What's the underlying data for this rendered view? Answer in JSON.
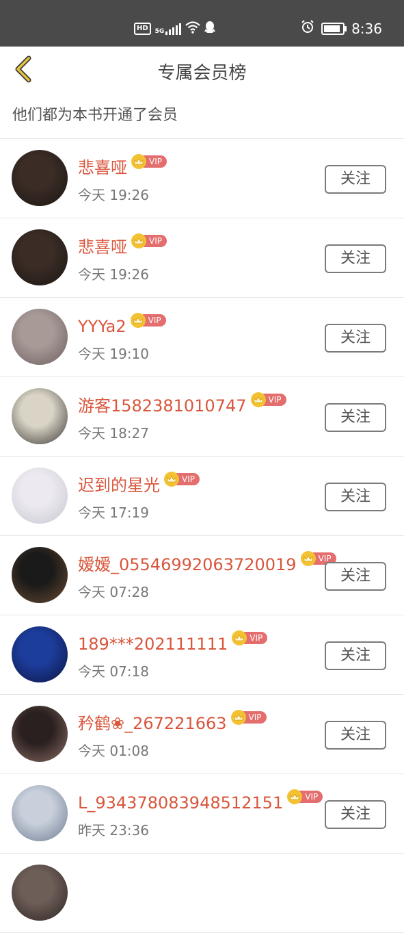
{
  "status_bar": {
    "network": "HD",
    "signal": "5G",
    "time": "8:36",
    "icons": [
      "hd-icon",
      "5g-signal-icon",
      "wifi-icon",
      "qq-icon",
      "alarm-icon",
      "battery-icon"
    ],
    "battery_level": 0.9
  },
  "header": {
    "title": "专属会员榜",
    "back_icon": "chevron-left-icon"
  },
  "subtitle": "他们都为本书开通了会员",
  "vip_label": "VIP",
  "follow_label": "关注",
  "members": [
    {
      "name": "悲喜哑",
      "time": "今天 19:26",
      "avatar_colors": [
        "#3b2c26",
        "#1a1612"
      ]
    },
    {
      "name": "悲喜哑",
      "time": "今天 19:26",
      "avatar_colors": [
        "#3b2c26",
        "#1a1612"
      ]
    },
    {
      "name": "YYYa2",
      "time": "今天 19:10",
      "avatar_colors": [
        "#a89a96",
        "#6d5f60"
      ]
    },
    {
      "name": "游客1582381010747",
      "time": "今天 18:27",
      "avatar_colors": [
        "#d9d4c6",
        "#3a3632"
      ]
    },
    {
      "name": "迟到的星光",
      "time": "今天 17:19",
      "avatar_colors": [
        "#eceaf0",
        "#c7c4d0"
      ]
    },
    {
      "name": "嫒嫒_05546992063720019",
      "time": "今天 07:28",
      "avatar_colors": [
        "#1a1a1a",
        "#6b4a30"
      ]
    },
    {
      "name": "189***202111111",
      "time": "今天 07:18",
      "avatar_colors": [
        "#1d3d9c",
        "#0a1440"
      ]
    },
    {
      "name": "矜鹤❀_267221663",
      "time": "今天 01:08",
      "avatar_colors": [
        "#2a2020",
        "#8c6c64"
      ]
    },
    {
      "name": "L_934378083948512151",
      "time": "昨天 23:36",
      "avatar_colors": [
        "#c9d0dc",
        "#6e7a90"
      ]
    },
    {
      "name": "",
      "time": "",
      "avatar_colors": [
        "#6e5e58",
        "#2c2422"
      ]
    }
  ],
  "colors": {
    "accent_name": "#d9563c",
    "vip_tag": "#e46d6d",
    "crown": "#f2c233",
    "status_bar_bg": "#4a4a4a",
    "back_icon": "#e8c43a"
  }
}
